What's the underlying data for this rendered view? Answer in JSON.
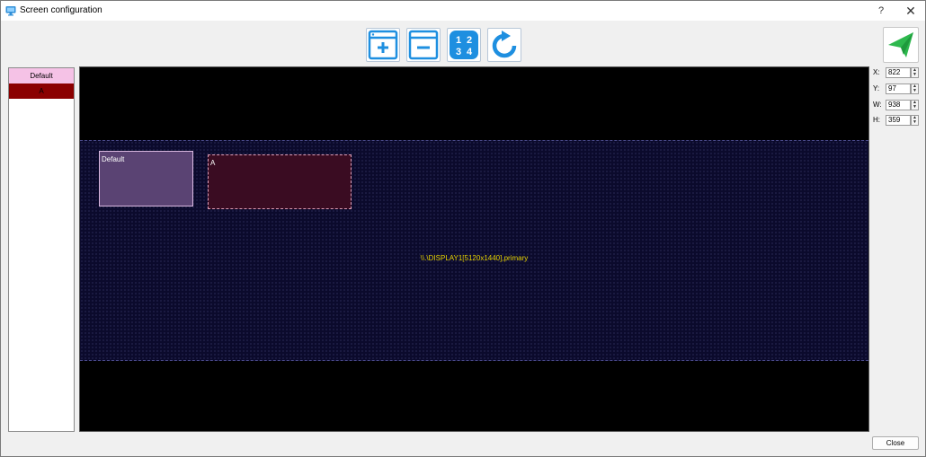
{
  "window": {
    "title": "Screen configuration",
    "help_label": "?",
    "close_glyph": "✕"
  },
  "toolbar": {
    "icons": [
      "add-screen-icon",
      "remove-screen-icon",
      "identify-screens-icon",
      "refresh-icon",
      "send-icon"
    ],
    "identify_digits": [
      "1",
      "2",
      "3",
      "4"
    ]
  },
  "screens_list": {
    "items": [
      {
        "label": "Default",
        "color": "#f5c2e6"
      },
      {
        "label": "A",
        "color": "#8b0000"
      }
    ]
  },
  "canvas": {
    "display_label": "\\\\.\\DISPLAY1[5120x1440],primary",
    "screens": [
      {
        "label": "Default"
      },
      {
        "label": "A"
      }
    ]
  },
  "fields": [
    {
      "label": "X:",
      "value": "822"
    },
    {
      "label": "Y:",
      "value": "97"
    },
    {
      "label": "W:",
      "value": "938"
    },
    {
      "label": "H:",
      "value": "359"
    }
  ],
  "footer": {
    "close_label": "Close"
  },
  "colors": {
    "accent_blue": "#1e8fe0",
    "send_green": "#2db84d",
    "display_text": "#e6d200"
  }
}
